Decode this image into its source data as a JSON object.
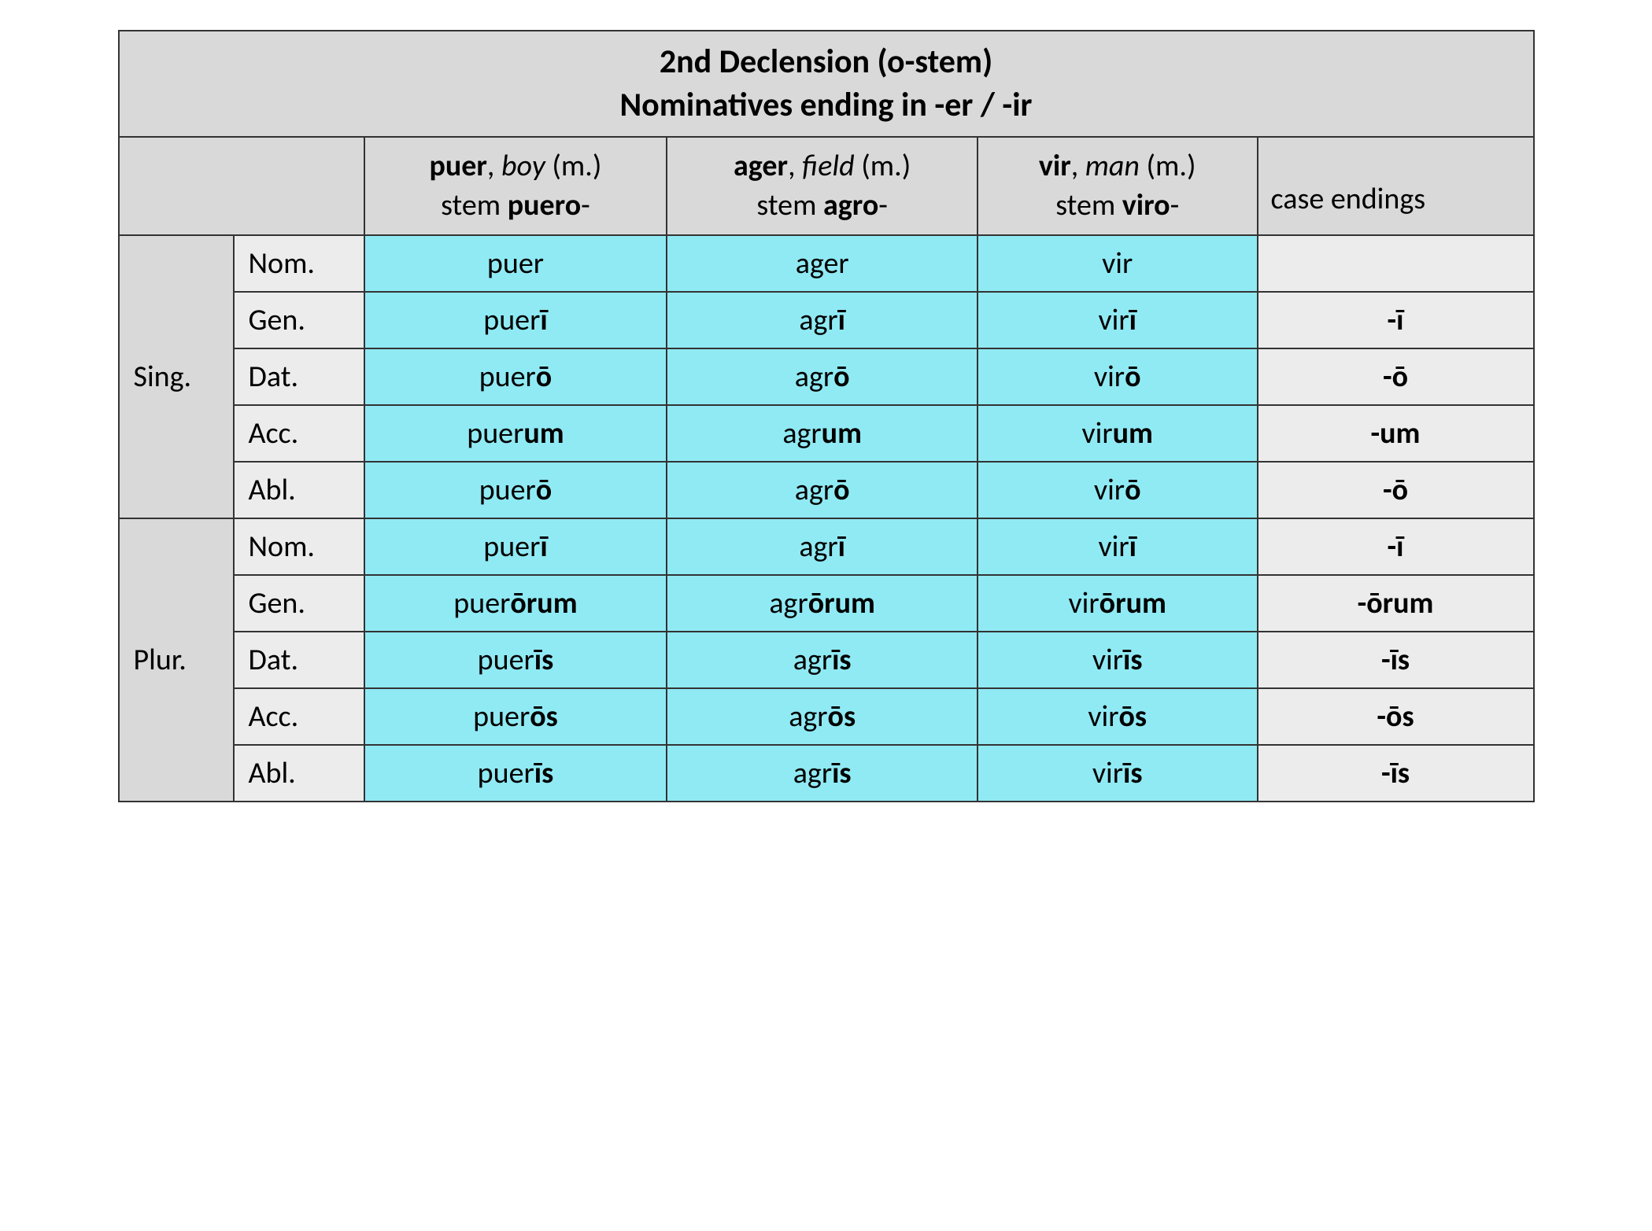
{
  "title_line1": "2nd Declension (o-stem)",
  "title_line2": "Nominatives ending in -er / -ir",
  "columns": [
    {
      "word": "puer",
      "meaning": "boy",
      "gender": "(m.)",
      "stem_prefix": "stem ",
      "stem": "puero",
      "stem_suffix": "-"
    },
    {
      "word": "ager",
      "meaning": "field",
      "gender": "(m.)",
      "stem_prefix": "stem ",
      "stem": "agro",
      "stem_suffix": "-"
    },
    {
      "word": "vir",
      "meaning": "man",
      "gender": "(m.)",
      "stem_prefix": "stem ",
      "stem": "viro",
      "stem_suffix": "-"
    }
  ],
  "case_endings_label": "case endings",
  "numbers": {
    "sing": "Sing.",
    "plur": "Plur."
  },
  "cases": [
    "Nom.",
    "Gen.",
    "Dat.",
    "Acc.",
    "Abl."
  ],
  "table": {
    "sing": [
      {
        "case": "Nom.",
        "cells": [
          {
            "root": "puer",
            "suf": ""
          },
          {
            "root": "ager",
            "suf": ""
          },
          {
            "root": "vir",
            "suf": ""
          }
        ],
        "ending": ""
      },
      {
        "case": "Gen.",
        "cells": [
          {
            "root": "puer",
            "suf": "ī"
          },
          {
            "root": "agr",
            "suf": "ī"
          },
          {
            "root": "vir",
            "suf": "ī"
          }
        ],
        "ending": "-ī"
      },
      {
        "case": "Dat.",
        "cells": [
          {
            "root": "puer",
            "suf": "ō"
          },
          {
            "root": "agr",
            "suf": "ō"
          },
          {
            "root": "vir",
            "suf": "ō"
          }
        ],
        "ending": "-ō"
      },
      {
        "case": "Acc.",
        "cells": [
          {
            "root": "puer",
            "suf": "um"
          },
          {
            "root": "agr",
            "suf": "um"
          },
          {
            "root": "vir",
            "suf": "um"
          }
        ],
        "ending": "-um"
      },
      {
        "case": "Abl.",
        "cells": [
          {
            "root": "puer",
            "suf": "ō"
          },
          {
            "root": "agr",
            "suf": "ō"
          },
          {
            "root": "vir",
            "suf": "ō"
          }
        ],
        "ending": "-ō"
      }
    ],
    "plur": [
      {
        "case": "Nom.",
        "cells": [
          {
            "root": "puer",
            "suf": "ī"
          },
          {
            "root": "agr",
            "suf": "ī"
          },
          {
            "root": "vir",
            "suf": "ī"
          }
        ],
        "ending": "-ī"
      },
      {
        "case": "Gen.",
        "cells": [
          {
            "root": "puer",
            "suf": "ōrum"
          },
          {
            "root": "agr",
            "suf": "ōrum"
          },
          {
            "root": "vir",
            "suf": "ōrum"
          }
        ],
        "ending": "-ōrum"
      },
      {
        "case": "Dat.",
        "cells": [
          {
            "root": "puer",
            "suf": "īs"
          },
          {
            "root": "agr",
            "suf": "īs"
          },
          {
            "root": "vir",
            "suf": "īs"
          }
        ],
        "ending": "-īs"
      },
      {
        "case": "Acc.",
        "cells": [
          {
            "root": "puer",
            "suf": "ōs"
          },
          {
            "root": "agr",
            "suf": "ōs"
          },
          {
            "root": "vir",
            "suf": "ōs"
          }
        ],
        "ending": "-ōs"
      },
      {
        "case": "Abl.",
        "cells": [
          {
            "root": "puer",
            "suf": "īs"
          },
          {
            "root": "agr",
            "suf": "īs"
          },
          {
            "root": "vir",
            "suf": "īs"
          }
        ],
        "ending": "-īs"
      }
    ]
  }
}
